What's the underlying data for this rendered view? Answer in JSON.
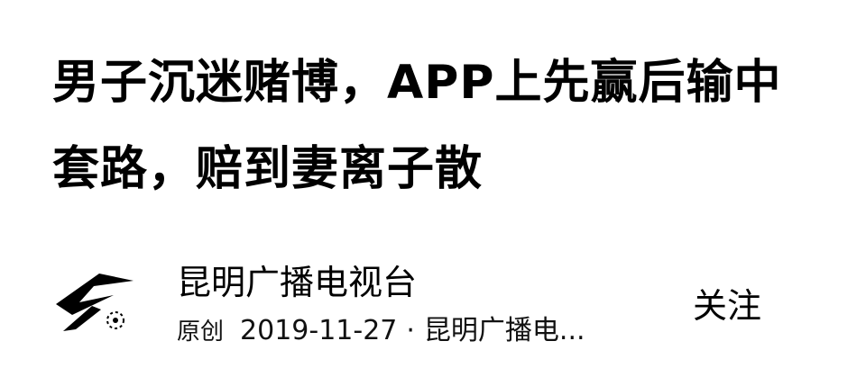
{
  "article": {
    "title": "男子沉迷赌博，APP上先赢后输中套路，赔到妻离子散"
  },
  "author": {
    "name": "昆明广播电视台",
    "avatar_icon": "broadcast-logo-icon"
  },
  "meta": {
    "original_tag": "原创",
    "date": "2019-11-27",
    "separator": "·",
    "source": "昆明广播电..."
  },
  "actions": {
    "follow_label": "关注"
  },
  "colors": {
    "background": "#ffffff",
    "text": "#000000"
  }
}
